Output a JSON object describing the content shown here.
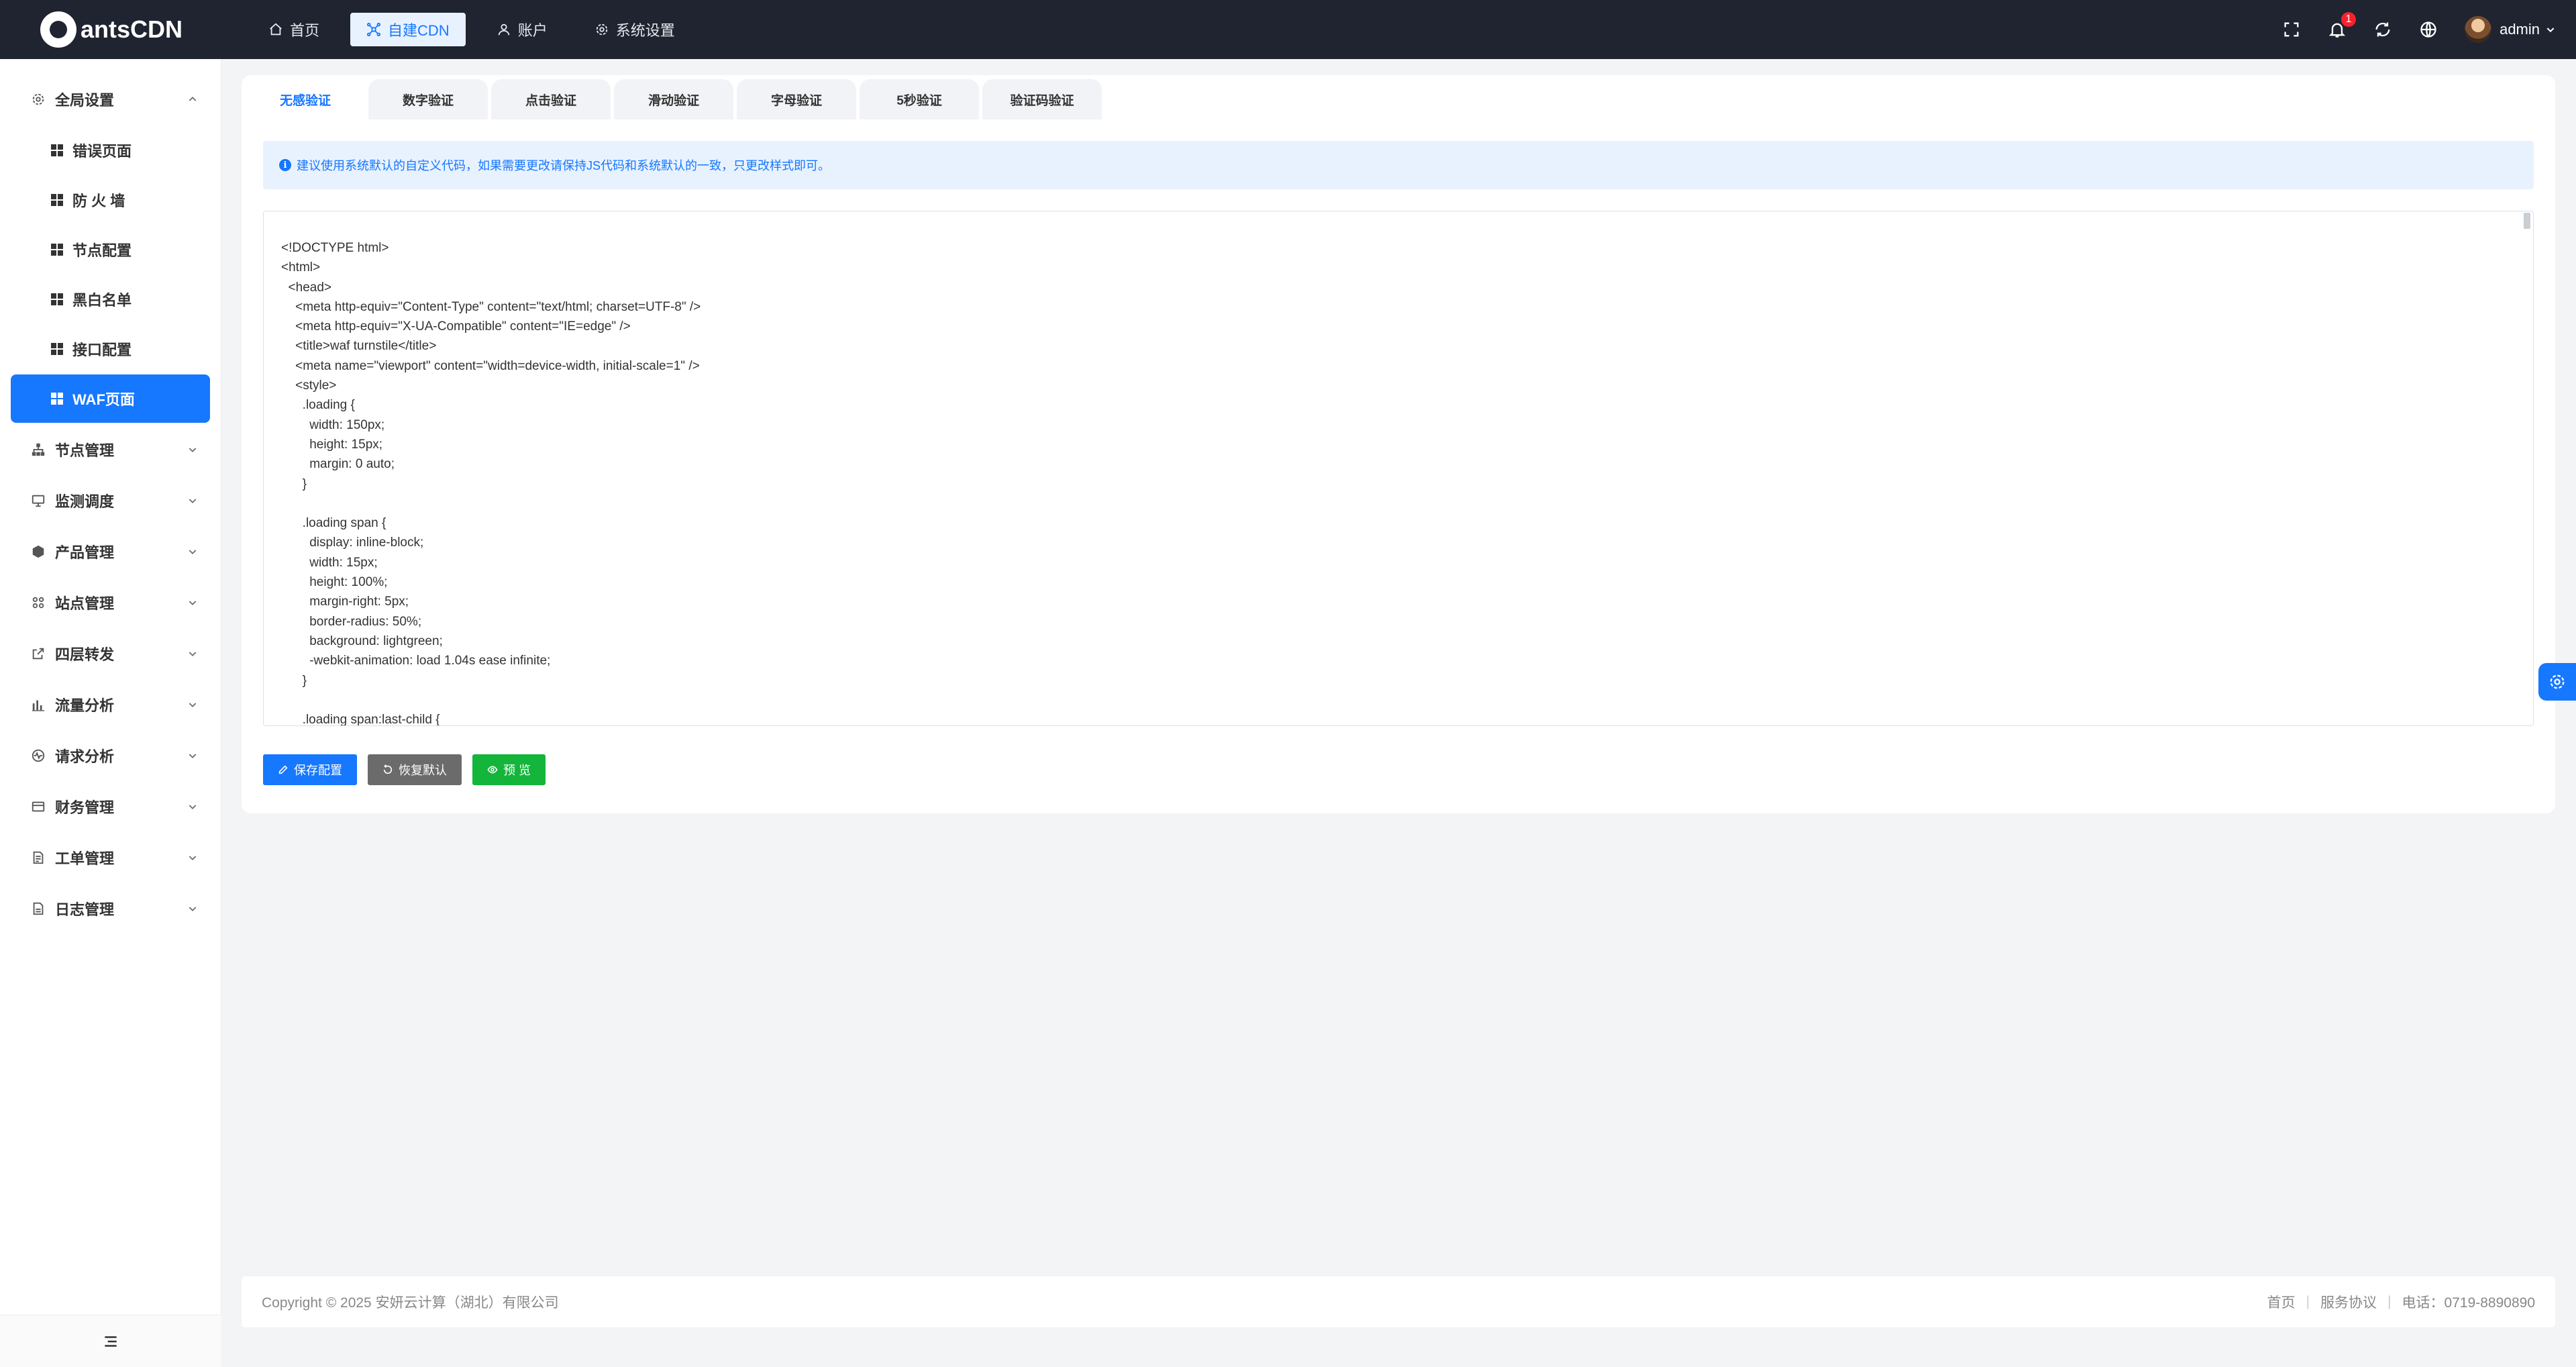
{
  "app": {
    "logo_text": "antsCDN"
  },
  "topnav": [
    {
      "label": "首页",
      "icon": "home-icon"
    },
    {
      "label": "自建CDN",
      "icon": "cdn-icon",
      "active": true
    },
    {
      "label": "账户",
      "icon": "user-icon"
    },
    {
      "label": "系统设置",
      "icon": "gear-icon"
    }
  ],
  "topbar": {
    "notification_count": "1",
    "username": "admin"
  },
  "sidebar": {
    "groups": [
      {
        "label": "全局设置",
        "expanded": true
      },
      {
        "label": "节点管理"
      },
      {
        "label": "监测调度"
      },
      {
        "label": "产品管理"
      },
      {
        "label": "站点管理"
      },
      {
        "label": "四层转发"
      },
      {
        "label": "流量分析"
      },
      {
        "label": "请求分析"
      },
      {
        "label": "财务管理"
      },
      {
        "label": "工单管理"
      },
      {
        "label": "日志管理"
      }
    ],
    "sub_items": [
      {
        "label": "错误页面"
      },
      {
        "label": "防 火 墙"
      },
      {
        "label": "节点配置"
      },
      {
        "label": "黑白名单"
      },
      {
        "label": "接口配置"
      },
      {
        "label": "WAF页面",
        "active": true
      }
    ]
  },
  "tabs": [
    "无感验证",
    "数字验证",
    "点击验证",
    "滑动验证",
    "字母验证",
    "5秒验证",
    "验证码验证"
  ],
  "notice": "建议使用系统默认的自定义代码，如果需要更改请保持JS代码和系统默认的一致，只更改样式即可。",
  "code_value": "<!DOCTYPE html>\n<html>\n  <head>\n    <meta http-equiv=\"Content-Type\" content=\"text/html; charset=UTF-8\" />\n    <meta http-equiv=\"X-UA-Compatible\" content=\"IE=edge\" />\n    <title>waf turnstile</title>\n    <meta name=\"viewport\" content=\"width=device-width, initial-scale=1\" />\n    <style>\n      .loading {\n        width: 150px;\n        height: 15px;\n        margin: 0 auto;\n      }\n\n      .loading span {\n        display: inline-block;\n        width: 15px;\n        height: 100%;\n        margin-right: 5px;\n        border-radius: 50%;\n        background: lightgreen;\n        -webkit-animation: load 1.04s ease infinite;\n      }\n\n      .loading span:last-child {",
  "buttons": {
    "save": "保存配置",
    "restore": "恢复默认",
    "preview": "预 览"
  },
  "footer": {
    "copyright": "Copyright © 2025 安妍云计算（湖北）有限公司",
    "links": [
      "首页",
      "服务协议",
      "电话：0719-8890890"
    ]
  },
  "colors": {
    "accent": "#1677ff",
    "topbar_bg": "#1f2430",
    "success": "#13b53b"
  }
}
